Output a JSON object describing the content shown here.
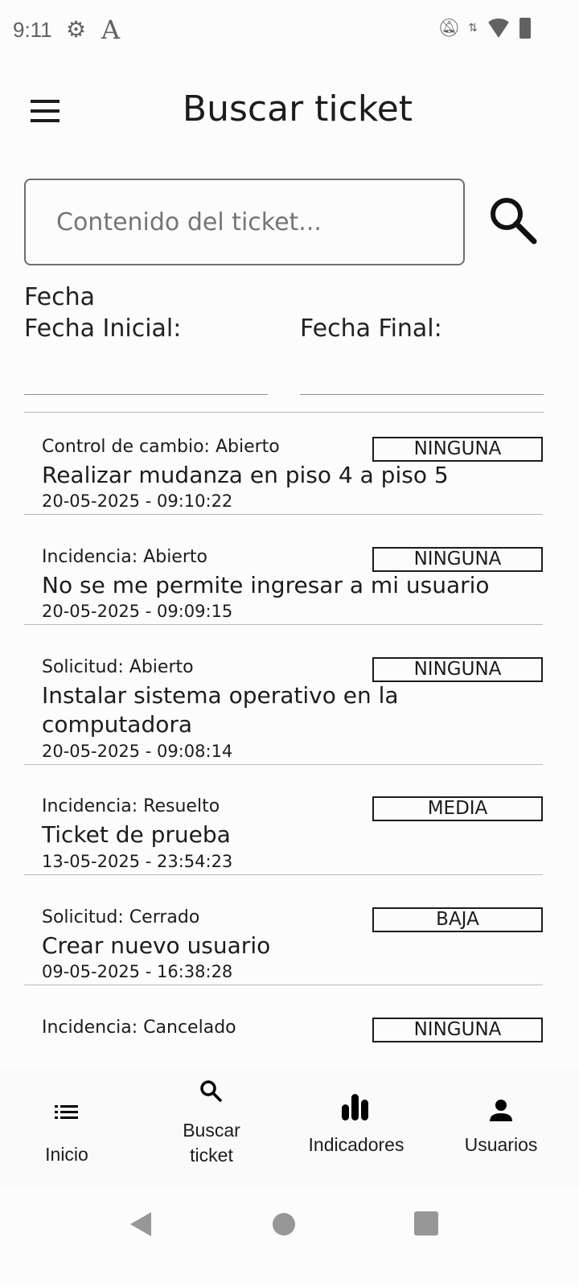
{
  "status_bar": {
    "time": "9:11"
  },
  "header": {
    "title": "Buscar ticket"
  },
  "search": {
    "placeholder": "Contenido del ticket..."
  },
  "filters": {
    "section_label": "Fecha",
    "start_label": "Fecha Inicial:",
    "end_label": "Fecha Final:"
  },
  "tickets": [
    {
      "type": "Control de cambio: Abierto",
      "priority": "NINGUNA",
      "title": "Realizar mudanza en piso 4 a piso 5",
      "date": "20-05-2025 - 09:10:22"
    },
    {
      "type": "Incidencia: Abierto",
      "priority": "NINGUNA",
      "title": "No se me permite ingresar a mi usuario",
      "date": "20-05-2025 - 09:09:15"
    },
    {
      "type": "Solicitud: Abierto",
      "priority": "NINGUNA",
      "title": "Instalar sistema operativo en la computadora",
      "date": "20-05-2025 - 09:08:14"
    },
    {
      "type": "Incidencia: Resuelto",
      "priority": "MEDIA",
      "title": "Ticket de prueba",
      "date": "13-05-2025 - 23:54:23"
    },
    {
      "type": "Solicitud: Cerrado",
      "priority": "BAJA",
      "title": "Crear nuevo usuario",
      "date": "09-05-2025 - 16:38:28"
    },
    {
      "type": "Incidencia: Cancelado",
      "priority": "NINGUNA",
      "title": "",
      "date": ""
    }
  ],
  "bottom_nav": [
    {
      "label": "Inicio",
      "icon": "list-icon"
    },
    {
      "label": "Buscar ticket",
      "icon": "search-icon"
    },
    {
      "label": "Indicadores",
      "icon": "bar-chart-icon"
    },
    {
      "label": "Usuarios",
      "icon": "person-icon"
    }
  ]
}
